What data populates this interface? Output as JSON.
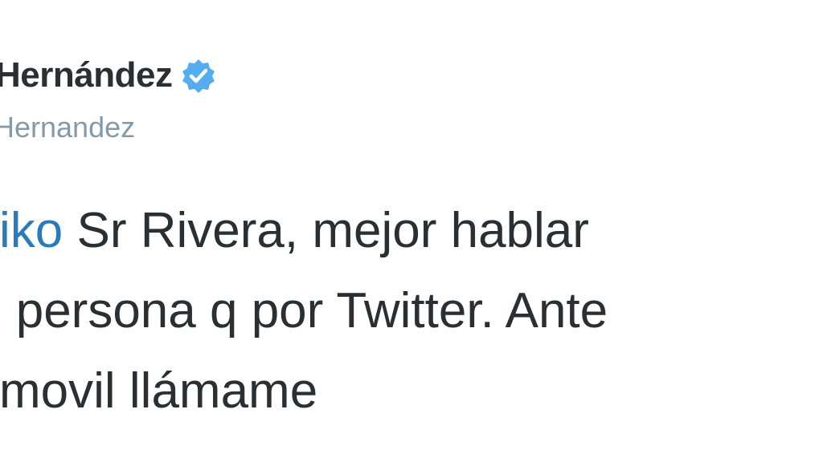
{
  "tweet": {
    "author": {
      "display_name": "Hernández",
      "verified": true,
      "handle": "Hernandez"
    },
    "text": {
      "mention": "kiko",
      "line1_rest": " Sr Rivera, mejor hablar",
      "line2": "n persona q por Twitter. Ante",
      "line3": "l movil llámame"
    }
  },
  "colors": {
    "name": "#292f33",
    "handle": "#8899a6",
    "mention": "#2b7bb9",
    "verified_badge": "#55acee"
  },
  "icons": {
    "verified": "verified-badge-icon"
  }
}
